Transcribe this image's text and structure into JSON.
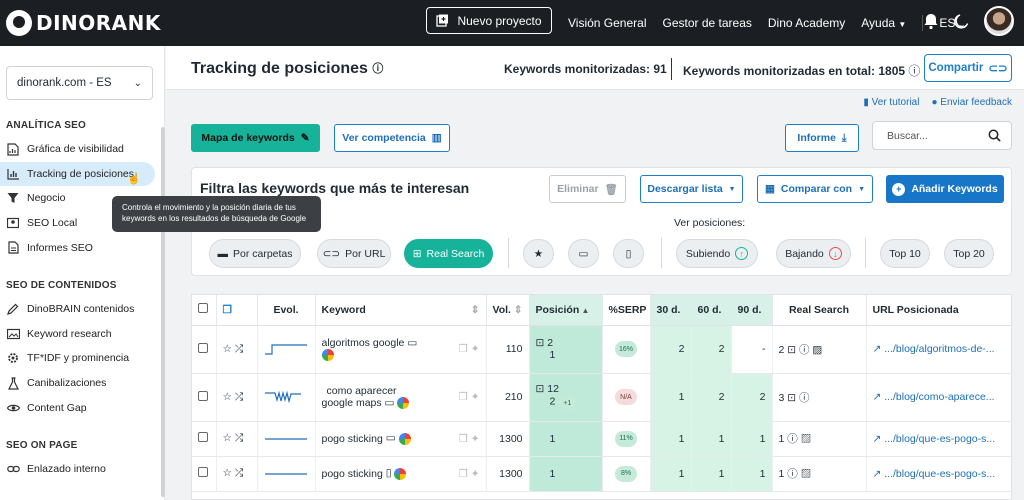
{
  "topbar": {
    "logo": "DINORANK",
    "new_project": "Nuevo proyecto",
    "nav": [
      "Visión General",
      "Gestor de tareas",
      "Dino Academy",
      "Ayuda"
    ],
    "language": "ES"
  },
  "sidebar": {
    "site": "dinorank.com - ES",
    "sections": [
      {
        "title": "ANALÍTICA SEO",
        "items": [
          "Gráfica de visibilidad",
          "Tracking de posiciones",
          "Negocio",
          "SEO Local",
          "Informes SEO"
        ]
      },
      {
        "title": "SEO DE CONTENIDOS",
        "items": [
          "DinoBRAIN contenidos",
          "Keyword research",
          "TF*IDF y prominencia",
          "Canibalizaciones",
          "Content Gap"
        ]
      },
      {
        "title": "SEO ON PAGE",
        "items": [
          "Enlazado interno"
        ]
      }
    ],
    "tooltip": "Controla el movimiento y la posición diaria de tus keywords en los resultados de búsqueda de Google"
  },
  "header": {
    "title": "Tracking de posiciones",
    "kw_monitored": "Keywords monitorizadas: 91",
    "kw_total": "Keywords monitorizadas en total: 1805",
    "share": "Compartir"
  },
  "links": {
    "tutorial": "Ver tutorial",
    "feedback": "Enviar feedback"
  },
  "toolbar": {
    "map": "Mapa de keywords",
    "competition": "Ver competencia",
    "report": "Informe",
    "search_placeholder": "Buscar..."
  },
  "filter": {
    "title": "Filtra las keywords que más te interesan",
    "delete": "Eliminar",
    "download": "Descargar lista",
    "compare": "Comparar con",
    "add": "Añadir Keywords",
    "view_positions": "Ver posiciones:",
    "by_folders": "Por carpetas",
    "by_url": "Por URL",
    "real_search": "Real Search",
    "rising": "Subiendo",
    "falling": "Bajando",
    "top10": "Top 10",
    "top20": "Top 20"
  },
  "table": {
    "headers": [
      "Evol.",
      "Keyword",
      "Vol.",
      "Posición",
      "%SERP",
      "30 d.",
      "60 d.",
      "90 d.",
      "Real Search",
      "URL Posicionada"
    ],
    "rows": [
      {
        "keyword": "algoritmos google",
        "vol": "110",
        "pos_main": "2",
        "pos_sub": "1",
        "serp": "16%",
        "d30": "2",
        "d60": "2",
        "d90": "-",
        "real": "2",
        "url": ".../blog/algoritmos-de-..."
      },
      {
        "keyword_l1": "como aparecer",
        "keyword_l2": "google maps",
        "vol": "210",
        "pos_main": "12",
        "pos_sub": "2",
        "pos_extra": "+1",
        "serp": "N/A",
        "d30": "1",
        "d60": "2",
        "d90": "2",
        "real": "3",
        "url": ".../blog/como-aparece..."
      },
      {
        "keyword": "pogo sticking",
        "vol": "1300",
        "pos_main": "1",
        "serp": "11%",
        "d30": "1",
        "d60": "1",
        "d90": "1",
        "real": "1",
        "url": ".../blog/que-es-pogo-s..."
      },
      {
        "keyword": "pogo sticking",
        "vol": "1300",
        "pos_main": "1",
        "serp": "8%",
        "d30": "1",
        "d60": "1",
        "d90": "1",
        "real": "1",
        "url": ".../blog/que-es-pogo-s..."
      }
    ]
  },
  "colors": {
    "accent_green": "#16b39a",
    "accent_blue": "#1876c9",
    "topbar": "#1b1f24"
  }
}
